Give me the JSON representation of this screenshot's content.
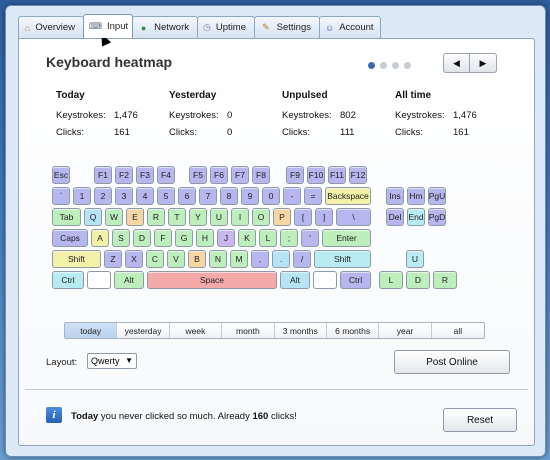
{
  "tabs": [
    {
      "label": "Overview",
      "icon": "home-icon"
    },
    {
      "label": "Input",
      "icon": "keyboard-icon",
      "active": true
    },
    {
      "label": "Network",
      "icon": "globe-icon"
    },
    {
      "label": "Uptime",
      "icon": "clock-icon"
    },
    {
      "label": "Settings",
      "icon": "wrench-icon"
    },
    {
      "label": "Account",
      "icon": "person-icon"
    }
  ],
  "title": "Keyboard heatmap",
  "pagination": {
    "total": 4,
    "active": 1,
    "prev": "◀",
    "next": "▶"
  },
  "stats": [
    {
      "heading": "Today",
      "keystrokes_label": "Keystrokes:",
      "keystrokes": "1,476",
      "clicks_label": "Clicks:",
      "clicks": "161"
    },
    {
      "heading": "Yesterday",
      "keystrokes_label": "Keystrokes:",
      "keystrokes": "0",
      "clicks_label": "Clicks:",
      "clicks": "0"
    },
    {
      "heading": "Unpulsed",
      "keystrokes_label": "Keystrokes:",
      "keystrokes": "802",
      "clicks_label": "Clicks:",
      "clicks": "111"
    },
    {
      "heading": "All time",
      "keystrokes_label": "Keystrokes:",
      "keystrokes": "1,476",
      "clicks_label": "Clicks:",
      "clicks": "161"
    }
  ],
  "keys": [
    {
      "label": "Esc",
      "color": "blue"
    },
    {
      "label": "F1",
      "color": "blue"
    },
    {
      "label": "F2",
      "color": "blue"
    },
    {
      "label": "F3",
      "color": "blue"
    },
    {
      "label": "F4",
      "color": "blue"
    },
    {
      "label": "F5",
      "color": "blue"
    },
    {
      "label": "F6",
      "color": "blue"
    },
    {
      "label": "F7",
      "color": "blue"
    },
    {
      "label": "F8",
      "color": "blue"
    },
    {
      "label": "F9",
      "color": "blue"
    },
    {
      "label": "F10",
      "color": "blue"
    },
    {
      "label": "F11",
      "color": "blue"
    },
    {
      "label": "F12",
      "color": "blue"
    },
    {
      "label": "`",
      "color": "blue"
    },
    {
      "label": "1",
      "color": "blue"
    },
    {
      "label": "2",
      "color": "blue"
    },
    {
      "label": "3",
      "color": "blue"
    },
    {
      "label": "4",
      "color": "blue"
    },
    {
      "label": "5",
      "color": "blue"
    },
    {
      "label": "6",
      "color": "blue"
    },
    {
      "label": "7",
      "color": "blue"
    },
    {
      "label": "8",
      "color": "blue"
    },
    {
      "label": "9",
      "color": "blue"
    },
    {
      "label": "0",
      "color": "blue"
    },
    {
      "label": "-",
      "color": "blue"
    },
    {
      "label": "=",
      "color": "blue"
    },
    {
      "label": "Backspace",
      "color": "yellow"
    },
    {
      "label": "Ins",
      "color": "blue"
    },
    {
      "label": "Hm",
      "color": "blue"
    },
    {
      "label": "PgU",
      "color": "blue"
    },
    {
      "label": "Tab",
      "color": "green"
    },
    {
      "label": "Q",
      "color": "lblue"
    },
    {
      "label": "W",
      "color": "green"
    },
    {
      "label": "E",
      "color": "orange"
    },
    {
      "label": "R",
      "color": "green"
    },
    {
      "label": "T",
      "color": "green"
    },
    {
      "label": "Y",
      "color": "green"
    },
    {
      "label": "U",
      "color": "green"
    },
    {
      "label": "I",
      "color": "green"
    },
    {
      "label": "O",
      "color": "green"
    },
    {
      "label": "P",
      "color": "orange"
    },
    {
      "label": "[",
      "color": "blue"
    },
    {
      "label": "]",
      "color": "blue"
    },
    {
      "label": "\\",
      "color": "blue"
    },
    {
      "label": "Del",
      "color": "blue"
    },
    {
      "label": "End",
      "color": "cyan"
    },
    {
      "label": "PgD",
      "color": "blue"
    },
    {
      "label": "Caps",
      "color": "blue"
    },
    {
      "label": "A",
      "color": "yellow"
    },
    {
      "label": "S",
      "color": "green"
    },
    {
      "label": "D",
      "color": "green"
    },
    {
      "label": "F",
      "color": "green"
    },
    {
      "label": "G",
      "color": "green"
    },
    {
      "label": "H",
      "color": "green"
    },
    {
      "label": "J",
      "color": "purple"
    },
    {
      "label": "K",
      "color": "green"
    },
    {
      "label": "L",
      "color": "green"
    },
    {
      "label": ";",
      "color": "green"
    },
    {
      "label": "'",
      "color": "blue"
    },
    {
      "label": "Enter",
      "color": "green"
    },
    {
      "label": "Shift",
      "color": "yellow"
    },
    {
      "label": "Z",
      "color": "blue"
    },
    {
      "label": "X",
      "color": "blue"
    },
    {
      "label": "C",
      "color": "green"
    },
    {
      "label": "V",
      "color": "green"
    },
    {
      "label": "B",
      "color": "orange"
    },
    {
      "label": "N",
      "color": "green"
    },
    {
      "label": "M",
      "color": "green"
    },
    {
      "label": ",",
      "color": "blue"
    },
    {
      "label": ".",
      "color": "lblue"
    },
    {
      "label": "/",
      "color": "blue"
    },
    {
      "label": "Shift",
      "color": "cyan"
    },
    {
      "label": "U",
      "color": "cyan"
    },
    {
      "label": "Ctrl",
      "color": "cyan"
    },
    {
      "label": "",
      "color": "white"
    },
    {
      "label": "Alt",
      "color": "green"
    },
    {
      "label": "Space",
      "color": "red"
    },
    {
      "label": "Alt",
      "color": "lblue"
    },
    {
      "label": "",
      "color": "white"
    },
    {
      "label": "Ctrl",
      "color": "blue"
    },
    {
      "label": "L",
      "color": "green"
    },
    {
      "label": "D",
      "color": "green"
    },
    {
      "label": "R",
      "color": "green"
    }
  ],
  "periods": [
    {
      "label": "today",
      "active": true
    },
    {
      "label": "yesterday"
    },
    {
      "label": "week"
    },
    {
      "label": "month"
    },
    {
      "label": "3 months"
    },
    {
      "label": "6 months"
    },
    {
      "label": "year"
    },
    {
      "label": "all"
    }
  ],
  "layout": {
    "label": "Layout:",
    "value": "Qwerty"
  },
  "post_online_label": "Post Online",
  "footer": {
    "msg_prefix": "Today",
    "msg_middle": " you never clicked so much. Already ",
    "msg_count": "160",
    "msg_suffix": " clicks!",
    "reset_label": "Reset"
  }
}
